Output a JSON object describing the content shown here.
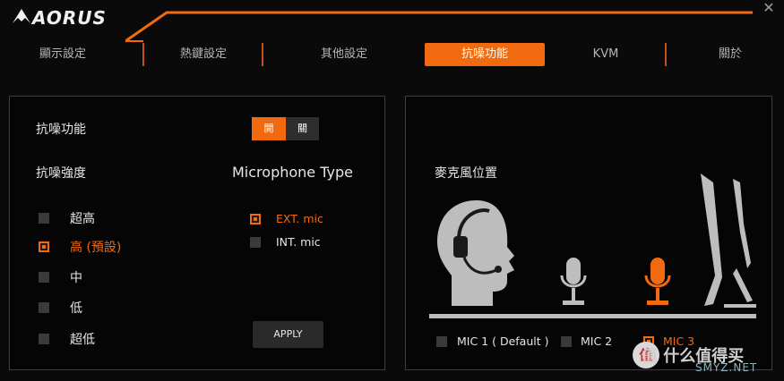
{
  "app": {
    "brand": "AORUS"
  },
  "tabs": [
    {
      "label": "顯示設定",
      "active": false
    },
    {
      "label": "熱鍵設定",
      "active": false
    },
    {
      "label": "其他設定",
      "active": false
    },
    {
      "label": "抗噪功能",
      "active": true
    },
    {
      "label": "KVM",
      "active": false
    },
    {
      "label": "關於",
      "active": false
    }
  ],
  "noise_panel": {
    "toggle_label": "抗噪功能",
    "toggle_on_label": "開",
    "toggle_off_label": "關",
    "toggle_state": "on",
    "strength_label": "抗噪強度",
    "strength_options": [
      {
        "label": "超高",
        "checked": false
      },
      {
        "label": "高 (預設)",
        "checked": true
      },
      {
        "label": "中",
        "checked": false
      },
      {
        "label": "低",
        "checked": false
      },
      {
        "label": "超低",
        "checked": false
      }
    ],
    "mic_type_label": "Microphone Type",
    "mic_types": [
      {
        "label": "EXT. mic",
        "checked": true
      },
      {
        "label": "INT. mic",
        "checked": false
      }
    ],
    "apply_label": "APPLY"
  },
  "mic_panel": {
    "title": "麥克風位置",
    "options": [
      {
        "label": "MIC 1 ( Default )",
        "checked": false
      },
      {
        "label": "MIC 2",
        "checked": false
      },
      {
        "label": "MIC 3",
        "checked": true
      }
    ]
  },
  "watermark": {
    "text": "值 什么值得买",
    "sub": "SMYZ.NET"
  },
  "colors": {
    "accent": "#f26a10",
    "background": "#0a0a0a",
    "panel_border": "#3c3c3c"
  }
}
